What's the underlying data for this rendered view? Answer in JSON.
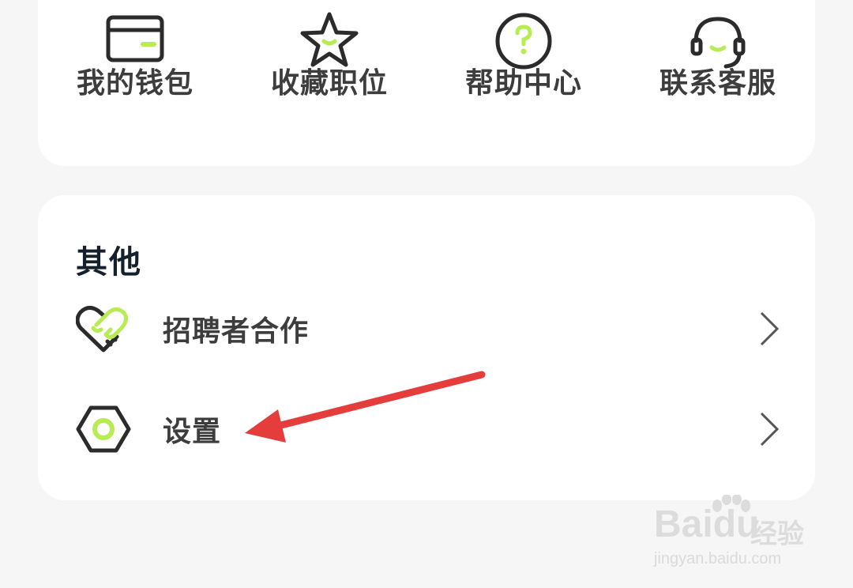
{
  "quick_actions": [
    {
      "label": "我的钱包",
      "icon": "wallet-icon"
    },
    {
      "label": "收藏职位",
      "icon": "star-icon"
    },
    {
      "label": "帮助中心",
      "icon": "help-icon"
    },
    {
      "label": "联系客服",
      "icon": "headset-icon"
    }
  ],
  "other_section": {
    "title": "其他",
    "items": [
      {
        "label": "招聘者合作",
        "icon": "handshake-heart-icon"
      },
      {
        "label": "设置",
        "icon": "hexagon-settings-icon"
      }
    ]
  },
  "colors": {
    "accent": "#b8ec55",
    "icon_stroke": "#2b2b2b",
    "annotation": "#e53c3c"
  },
  "watermark": {
    "logo": "Baidu",
    "text": "经验",
    "url": "jingyan.baidu.com"
  }
}
